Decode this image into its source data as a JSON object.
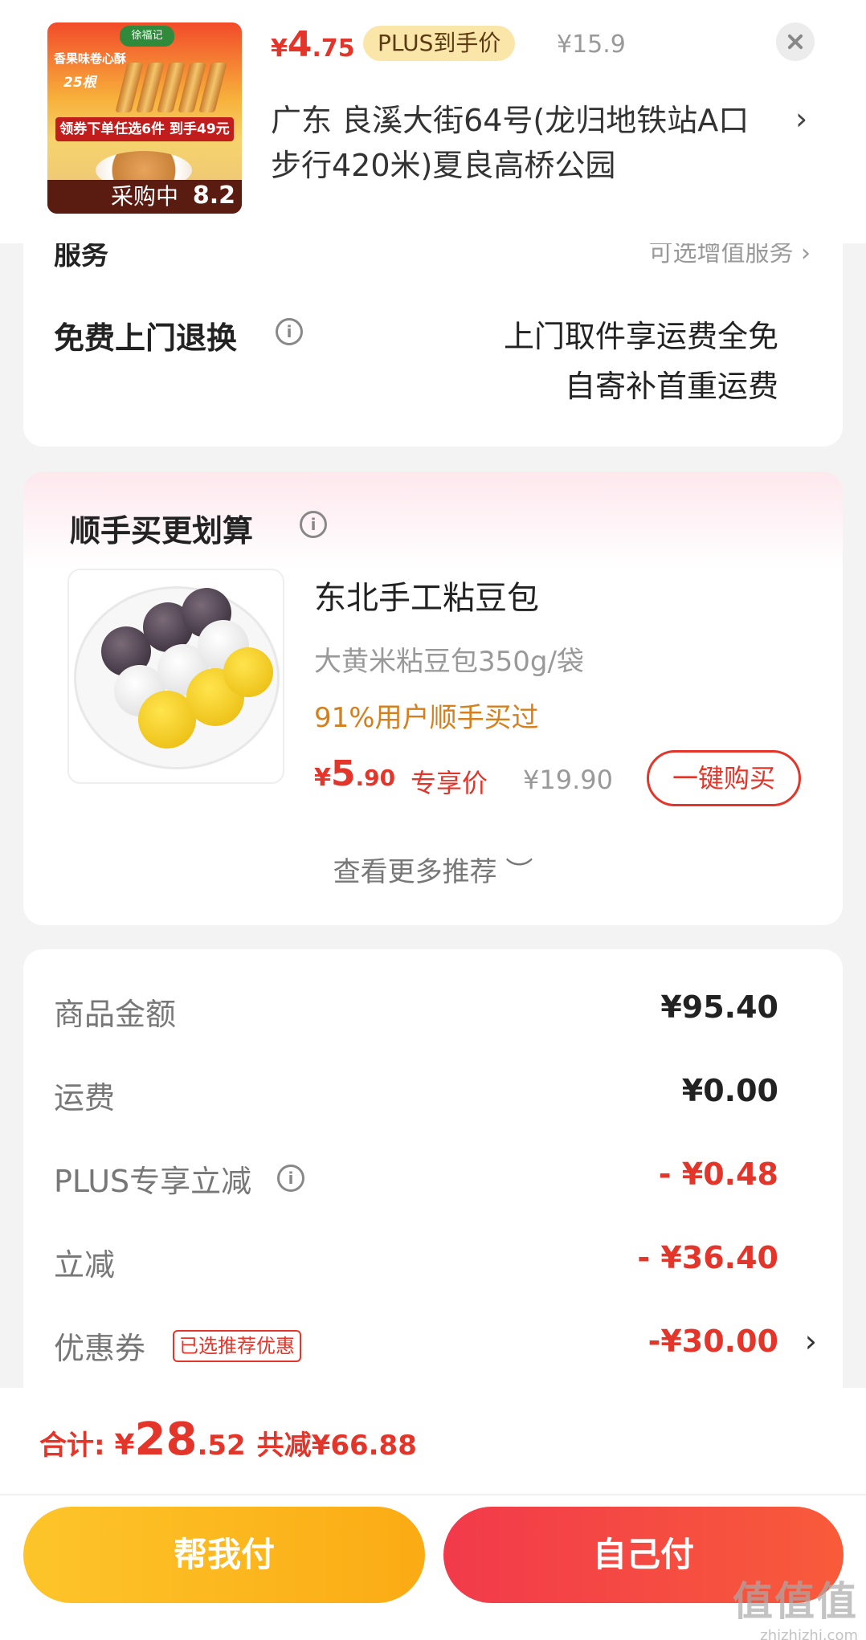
{
  "header": {
    "thumbnail": {
      "brand": "徐福记",
      "line1": "香果味卷心酥",
      "line2": "25根",
      "promo": "领券下单任选6件 到手49元",
      "status": "采购中",
      "corner_price": "8.2"
    },
    "price": {
      "symbol": "¥",
      "integer": "4",
      "decimal": ".75"
    },
    "plus_tag": "PLUS到手价",
    "original_price": "¥15.9",
    "address": "广东  良溪大街64号(龙归地铁站A口步行420米)夏良高桥公园"
  },
  "service": {
    "cut_label": "服务",
    "cut_right": "可选增值服务",
    "return_label": "免费上门退换",
    "return_desc_line1": "上门取件享运费全免",
    "return_desc_line2": "自寄补首重运费"
  },
  "recommend": {
    "title": "顺手买更划算",
    "product": {
      "name": "东北手工粘豆包",
      "spec": "大黄米粘豆包350g/袋",
      "rate": "91%用户顺手买过",
      "price": {
        "symbol": "¥",
        "integer": "5",
        "decimal": ".90"
      },
      "exclusive": "专享价",
      "original_price": "¥19.90",
      "buy_button": "一键购买"
    },
    "more": "查看更多推荐 ︶"
  },
  "summary": {
    "rows": [
      {
        "label": "商品金额",
        "value": "¥95.40"
      },
      {
        "label": "运费",
        "value": "¥0.00"
      },
      {
        "label": "PLUS专享立减",
        "value": "- ¥0.48"
      },
      {
        "label": "立减",
        "value": "- ¥36.40"
      },
      {
        "label": "优惠券",
        "value": "-¥30.00",
        "tag": "已选推荐优惠"
      }
    ]
  },
  "bottom": {
    "total_label": "合计: ",
    "total": {
      "symbol": "¥",
      "integer": "28",
      "decimal": ".52"
    },
    "saved": "共减¥66.88",
    "help_pay": "帮我付",
    "self_pay": "自己付"
  },
  "watermark": {
    "text": "值值值",
    "domain": "zhizhizhi.com"
  },
  "colors": {
    "accent_red": "#e4352a",
    "gold": "#fbab14",
    "tag_bg": "#fbe6a9"
  }
}
